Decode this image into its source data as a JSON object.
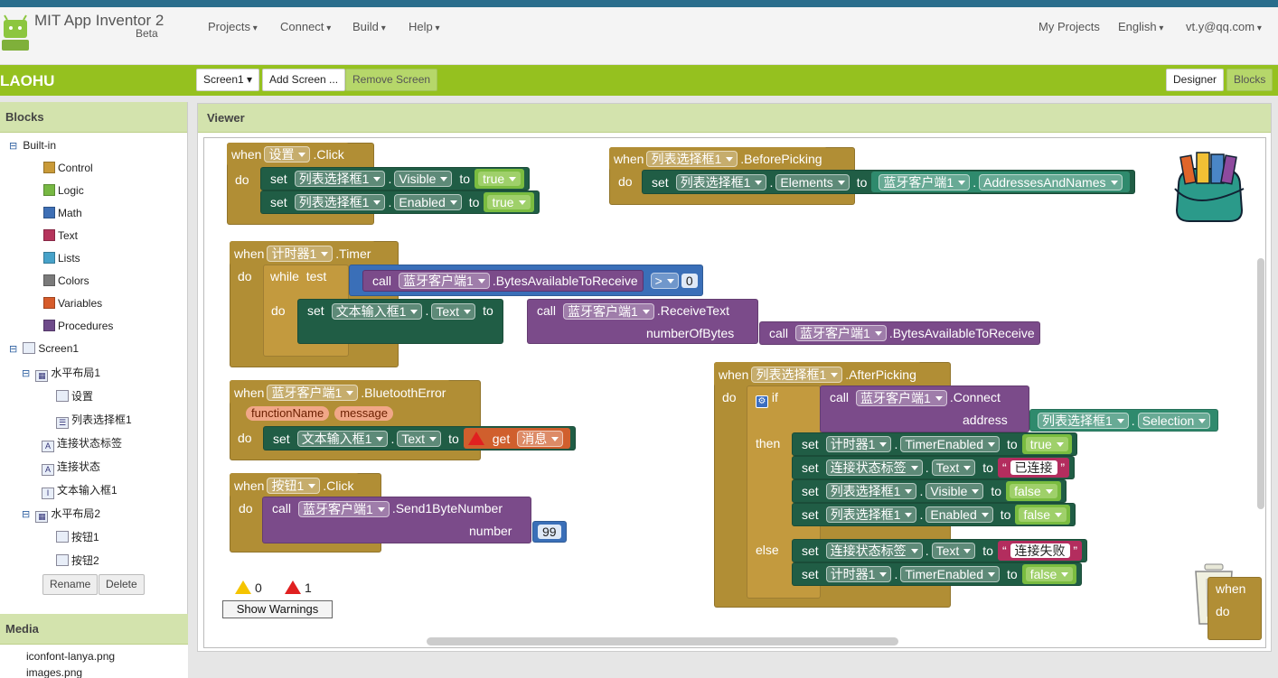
{
  "header": {
    "app_name": "MIT App Inventor 2",
    "beta": "Beta",
    "menus": [
      "Projects",
      "Connect",
      "Build",
      "Help"
    ],
    "my_projects": "My Projects",
    "language": "English",
    "account": "vt.y@qq.com"
  },
  "toolbar": {
    "project": "LAOHU",
    "screen": "Screen1",
    "add_screen": "Add Screen ...",
    "remove_screen": "Remove Screen",
    "designer": "Designer",
    "blocks": "Blocks"
  },
  "blocks_panel": {
    "title": "Blocks",
    "builtin": "Built-in",
    "builtins": [
      "Control",
      "Logic",
      "Math",
      "Text",
      "Lists",
      "Colors",
      "Variables",
      "Procedures"
    ],
    "swatch_colors": [
      "#c99a38",
      "#77b843",
      "#3e6fb5",
      "#b5345c",
      "#47a2c9",
      "#7a7a7a",
      "#d65b2a",
      "#6e4a8a"
    ],
    "components": {
      "screen": "Screen1",
      "hl1": "水平布局1",
      "btn_settings": "设置",
      "listpicker": "列表选择框1",
      "status_label": "连接状态标签",
      "status": "连接状态",
      "textbox": "文本输入框1",
      "hl2": "水平布局2",
      "btn1": "按钮1",
      "btn2": "按钮2"
    },
    "rename": "Rename",
    "delete": "Delete"
  },
  "media": {
    "title": "Media",
    "files": [
      "iconfont-lanya.png",
      "images.png"
    ]
  },
  "viewer": {
    "title": "Viewer"
  },
  "kw": {
    "when": "when",
    "do": "do",
    "set": "set",
    "to": "to",
    "call": "call",
    "while": "while",
    "test": "test",
    "if": "if",
    "then": "then",
    "else": "else",
    "get": "get",
    "dot": "."
  },
  "b1": {
    "comp": "设置",
    "event": ".Click",
    "target": "列表选择框1",
    "p1": "Visible",
    "v1": "true",
    "p2": "Enabled",
    "v2": "true"
  },
  "b2": {
    "comp": "列表选择框1",
    "event": ".BeforePicking",
    "prop": "Elements",
    "src": "蓝牙客户端1",
    "srcprop": "AddressesAndNames"
  },
  "b3": {
    "comp": "计时器1",
    "event": ".Timer",
    "bt": "蓝牙客户端1",
    "method": ".BytesAvailableToReceive",
    "op": ">",
    "zero": "0",
    "tb": "文本输入框1",
    "prop": "Text",
    "recv": ".ReceiveText",
    "arg": "numberOfBytes"
  },
  "b4": {
    "comp": "蓝牙客户端1",
    "event": ".BluetoothError",
    "param1": "functionName",
    "param2": "message",
    "tb": "文本输入框1",
    "prop": "Text",
    "var": "消息"
  },
  "b5": {
    "comp": "按钮1",
    "event": ".Click",
    "bt": "蓝牙客户端1",
    "method": ".Send1ByteNumber",
    "arg": "number",
    "val": "99"
  },
  "b6": {
    "comp": "列表选择框1",
    "event": ".AfterPicking",
    "bt": "蓝牙客户端1",
    "method": ".Connect",
    "arg": "address",
    "lp": "列表选择框1",
    "selection": "Selection",
    "timer": "计时器1",
    "te": "TimerEnabled",
    "true": "true",
    "false": "false",
    "label": "连接状态标签",
    "text": "Text",
    "connected": "已连接",
    "failed": "连接失败",
    "visible": "Visible",
    "enabled": "Enabled"
  },
  "b7": {
    "when": "when",
    "do": "do"
  },
  "warnings": {
    "warn_count": "0",
    "error_count": "1",
    "button": "Show Warnings"
  }
}
